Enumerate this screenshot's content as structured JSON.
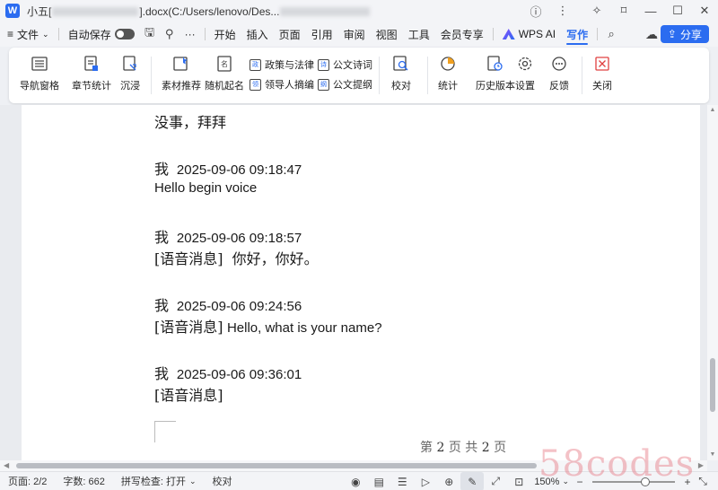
{
  "window": {
    "title_prefix": "小五[",
    "title_middle": "].docx(C:/Users/lenovo/Des...",
    "app_badge": "W"
  },
  "menubar": {
    "file_label": "文件",
    "autosave_label": "自动保存",
    "more_label": "···",
    "tabs": [
      "开始",
      "插入",
      "页面",
      "引用",
      "审阅",
      "视图",
      "工具",
      "会员专享"
    ],
    "wps_ai_label": "WPS AI",
    "active_tab": "写作",
    "share_label": "分享"
  },
  "ribbon": {
    "nav_pane": "导航窗格",
    "chapter_stats": "章节统计",
    "immersive": "沉浸",
    "material": "素材推荐",
    "random_name": "随机起名",
    "policy_law": "政策与法律",
    "leader_excerpt": "领导人摘编",
    "official_poetry": "公文诗词",
    "official_outline": "公文提纲",
    "proofread": "校对",
    "statistics": "统计",
    "history": "历史版本",
    "settings": "设置",
    "feedback": "反馈",
    "close": "关闭"
  },
  "document": {
    "lines": [
      {
        "text": "没事，拜拜"
      },
      {
        "speaker": "我",
        "time": "2025-09-06 09:18:47"
      },
      {
        "text": "Hello begin voice"
      },
      {
        "speaker": "我",
        "time": "2025-09-06 09:18:57"
      },
      {
        "tag": "[语音消息]",
        "text": "你好，你好。"
      },
      {
        "speaker": "我",
        "time": "2025-09-06 09:24:56"
      },
      {
        "tag": "[语音消息]",
        "text": "Hello, what is your name?"
      },
      {
        "speaker": "我",
        "time": "2025-09-06 09:36:01"
      },
      {
        "tag": "[语音消息]",
        "text": ""
      }
    ],
    "footer_prefix": "第",
    "footer_page": "2",
    "footer_mid": "页  共",
    "footer_total": "2",
    "footer_suffix": "页"
  },
  "statusbar": {
    "page": "页面: 2/2",
    "word_count": "字数: 662",
    "spell_check": "拼写检查: 打开",
    "proof": "校对",
    "zoom": "150%"
  },
  "watermark": "58codes"
}
